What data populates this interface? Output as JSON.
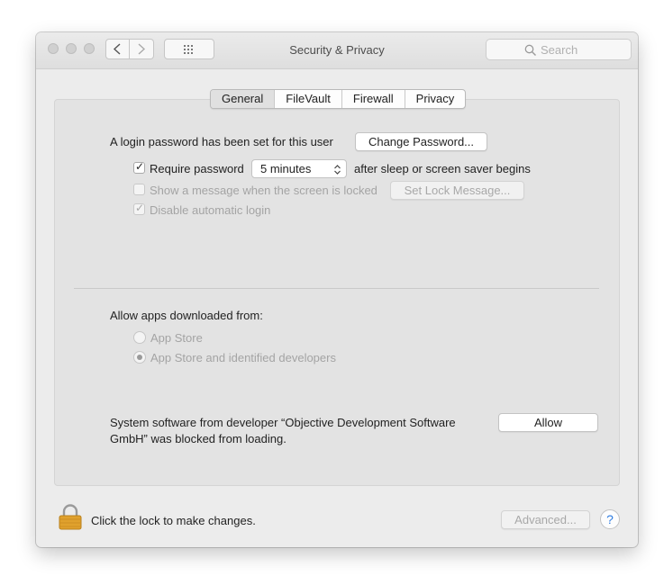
{
  "window": {
    "title": "Security & Privacy",
    "search_placeholder": "Search"
  },
  "tabs": [
    "General",
    "FileVault",
    "Firewall",
    "Privacy"
  ],
  "selected_tab": "General",
  "general": {
    "login_password_text": "A login password has been set for this user",
    "change_password_label": "Change Password...",
    "require_password": {
      "label": "Require password",
      "checked": true
    },
    "require_interval": "5 minutes",
    "after_sleep_text": "after sleep or screen saver begins",
    "show_message": {
      "label": "Show a message when the screen is locked",
      "checked": false,
      "enabled": false
    },
    "set_lock_message_label": "Set Lock Message...",
    "disable_auto_login": {
      "label": "Disable automatic login",
      "checked": true,
      "enabled": false
    }
  },
  "downloads": {
    "heading": "Allow apps downloaded from:",
    "options": [
      {
        "label": "App Store",
        "selected": false
      },
      {
        "label": "App Store and identified developers",
        "selected": true
      }
    ]
  },
  "blocked": {
    "line1": "System software from developer “Objective Development Software",
    "line2": "GmbH” was blocked from loading.",
    "allow_label": "Allow"
  },
  "footer": {
    "lock_text": "Click the lock to make changes.",
    "advanced_label": "Advanced...",
    "help_label": "?"
  },
  "colors": {
    "window_bg": "#ececec",
    "panel_bg": "#e3e3e3",
    "lock_icon": "#e0a12d",
    "help_icon": "#2f7ce0"
  }
}
